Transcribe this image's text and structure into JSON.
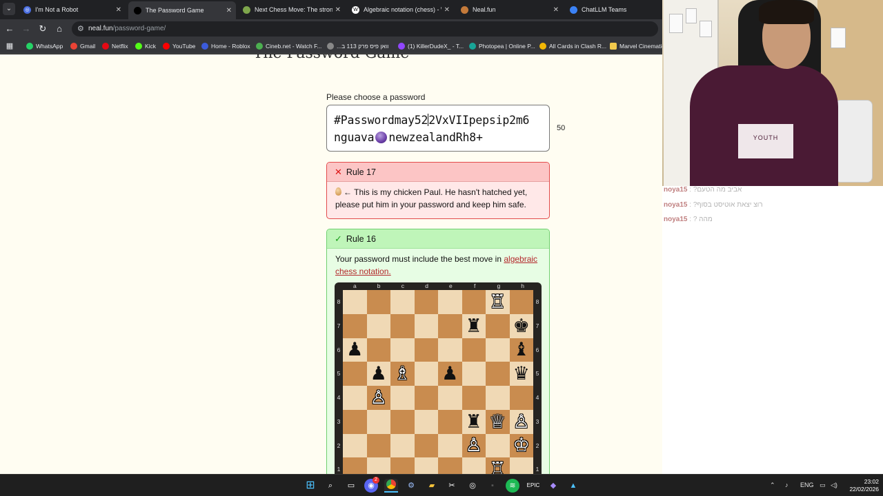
{
  "browser": {
    "tabs": [
      {
        "title": "I'm Not a Robot",
        "favicon_color": "#4a6ee0",
        "active": false
      },
      {
        "title": "The Password Game",
        "favicon_color": "#000000",
        "active": true
      },
      {
        "title": "Next Chess Move: The strongest",
        "favicon_color": "#7ea64c",
        "active": false
      },
      {
        "title": "Algebraic notation (chess) - Wiki",
        "favicon_color": "#ffffff",
        "active": false
      },
      {
        "title": "Neal.fun",
        "favicon_color": "#c47a3a",
        "active": false
      },
      {
        "title": "ChatLLM Teams",
        "favicon_color": "#3b82f6",
        "active": false
      }
    ],
    "url_host": "neal.fun",
    "url_path": "/password-game/",
    "bookmarks": [
      {
        "label": "WhatsApp",
        "color": "#25d366"
      },
      {
        "label": "Gmail",
        "color": "#ea4335"
      },
      {
        "label": "Netflix",
        "color": "#e50914"
      },
      {
        "label": "Kick",
        "color": "#53fc18"
      },
      {
        "label": "YouTube",
        "color": "#ff0000"
      },
      {
        "label": "Home - Roblox",
        "color": "#3b5bdb"
      },
      {
        "label": "Cineb.net - Watch F...",
        "color": "#4caf50"
      },
      {
        "label": "...וואן פיס פרק 113 ב",
        "color": "#888888"
      },
      {
        "label": "(1) KillerDudeX_ - T...",
        "color": "#9146ff"
      },
      {
        "label": "Photopea | Online P...",
        "color": "#18a497"
      },
      {
        "label": "All Cards in Clash R...",
        "color": "#f2b705"
      },
      {
        "label": "Marvel Cinematic",
        "color": "#f2c94c"
      }
    ]
  },
  "page": {
    "title_partial": "The Password Game",
    "prompt": "Please choose a password",
    "password_line1_before_caret": "#Passwordmay52",
    "password_line1_after_caret": "2VxVIIpepsip2m6",
    "password_line2_before_moon": "nguava",
    "password_line2_after_moon": "newzealandRh8+",
    "char_count": "50",
    "rules": [
      {
        "label": "Rule 17",
        "status": "fail",
        "symbol": "✕",
        "text": "← This is my chicken Paul. He hasn't hatched yet, please put him in your password and keep him safe."
      },
      {
        "label": "Rule 16",
        "status": "pass",
        "symbol": "✓",
        "text_before_link": "Your password must include the best move in ",
        "link_text": "algebraic chess notation."
      }
    ],
    "board": {
      "files": [
        "a",
        "b",
        "c",
        "d",
        "e",
        "f",
        "g",
        "h"
      ],
      "ranks": [
        "8",
        "7",
        "6",
        "5",
        "4",
        "3",
        "2",
        "1"
      ],
      "pieces": [
        {
          "square": "g8",
          "piece": "♖",
          "color": "white"
        },
        {
          "square": "f7",
          "piece": "♜",
          "color": "black"
        },
        {
          "square": "h7",
          "piece": "♚",
          "color": "black"
        },
        {
          "square": "a6",
          "piece": "♟",
          "color": "black"
        },
        {
          "square": "h6",
          "piece": "♝",
          "color": "black"
        },
        {
          "square": "b5",
          "piece": "♟",
          "color": "black"
        },
        {
          "square": "c5",
          "piece": "♗",
          "color": "white"
        },
        {
          "square": "e5",
          "piece": "♟",
          "color": "black"
        },
        {
          "square": "h5",
          "piece": "♛",
          "color": "black"
        },
        {
          "square": "b4",
          "piece": "♙",
          "color": "white"
        },
        {
          "square": "f3",
          "piece": "♜",
          "color": "black"
        },
        {
          "square": "g3",
          "piece": "♕",
          "color": "white"
        },
        {
          "square": "h3",
          "piece": "♙",
          "color": "white"
        },
        {
          "square": "f2",
          "piece": "♙",
          "color": "white"
        },
        {
          "square": "h2",
          "piece": "♔",
          "color": "white"
        },
        {
          "square": "g1",
          "piece": "♖",
          "color": "white"
        }
      ]
    }
  },
  "stream": {
    "hoodie_text": "YOUTH",
    "chat": [
      {
        "user": "noya15",
        "text": "?אביב מה הטעם"
      },
      {
        "user": "noya15",
        "text": "?רוצ יצאת אוטיסט בסוף"
      },
      {
        "user": "noya15",
        "text": "? מהה"
      }
    ]
  },
  "taskbar": {
    "language": "ENG",
    "time": "23:02",
    "date": "22/02/2026",
    "discord_badge": "2"
  }
}
